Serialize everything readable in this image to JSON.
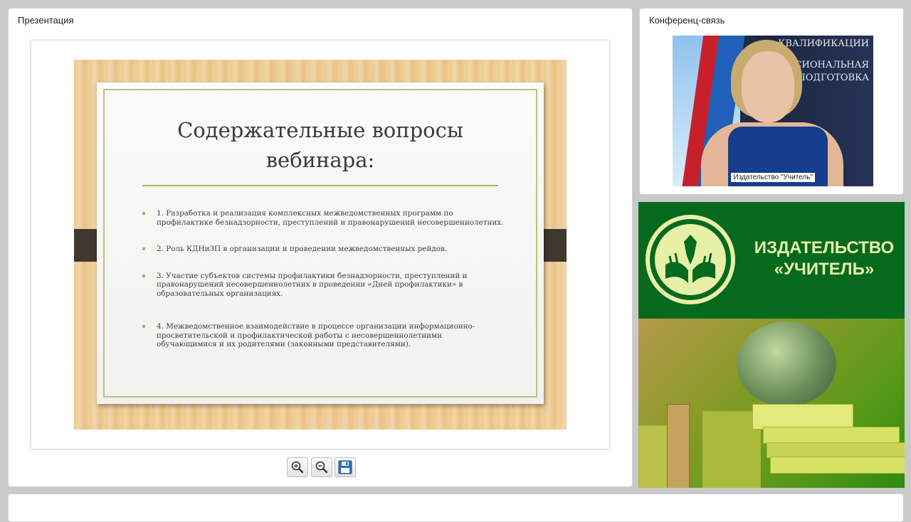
{
  "presentation_panel": {
    "title": "Презентация",
    "slide": {
      "title_line1": "Содержательные вопросы",
      "title_line2": "вебинара:",
      "items": [
        "1. Разработка и реализация комплексных межведомственных программ по профилактике безнадзорности, преступлений и правонарушений несовершеннолетних.",
        "2. Роль КДНиЗП в организации и проведении межведомственных рейдов.",
        "3. Участие субъектов системы профилактики безнадзорности, преступлений и правонарушений несовершеннолетних в проведении «Дней профилактики» в образовательных организациях.",
        "4. Межведомственное взаимодействие в процессе организации информационно-просветительской и профилактической работы с несовершеннолетними обучающимися и их родителями (законными представителями)."
      ]
    },
    "toolbar": {
      "zoom_in_icon": "zoom-in-icon",
      "zoom_out_icon": "zoom-out-icon",
      "save_icon": "floppy-disk-icon"
    }
  },
  "conference_panel": {
    "title": "Конференц-связь",
    "video": {
      "caption": "Издательство \"Учитель\"",
      "background_text": [
        "КВАЛИФИКАЦИИ",
        "СИОНАЛЬНАЯ",
        "ПОДГОТОВКА"
      ]
    }
  },
  "ad": {
    "name_line1": "ИЗДАТЕЛЬСТВО",
    "name_line2": "«УЧИТЕЛЬ»",
    "brand_green": "#066a1e",
    "accent_yellow": "#e8f0a8"
  }
}
